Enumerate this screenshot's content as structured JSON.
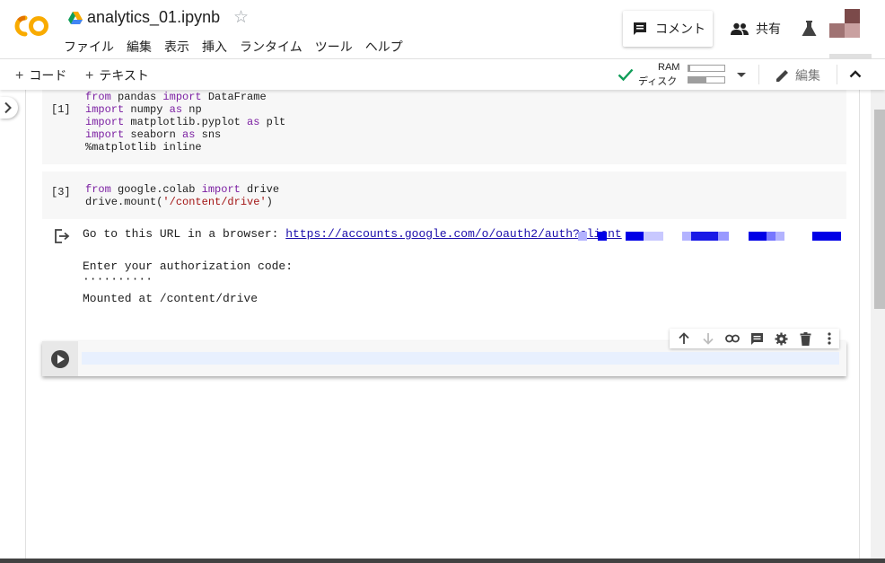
{
  "header": {
    "doc_title": "analytics_01.ipynb",
    "menu": [
      "ファイル",
      "編集",
      "表示",
      "挿入",
      "ランタイム",
      "ツール",
      "ヘルプ"
    ],
    "comment_label": "コメント",
    "share_label": "共有",
    "logo_letters": "CO"
  },
  "toolbar": {
    "add_code_label": "コード",
    "add_text_label": "テキスト",
    "ram_label": "RAM",
    "disk_label": "ディスク",
    "ram_usage": 0.05,
    "disk_usage": 0.5,
    "edit_label": "編集"
  },
  "cells": [
    {
      "exec_count": "[1]",
      "lines": [
        [
          {
            "t": "from",
            "c": "kw"
          },
          {
            "t": " pandas "
          },
          {
            "t": "import",
            "c": "kw"
          },
          {
            "t": " DataFrame"
          }
        ],
        [
          {
            "t": "import",
            "c": "kw"
          },
          {
            "t": " numpy "
          },
          {
            "t": "as",
            "c": "kw"
          },
          {
            "t": " np"
          }
        ],
        [
          {
            "t": "import",
            "c": "kw"
          },
          {
            "t": " matplotlib.pyplot "
          },
          {
            "t": "as",
            "c": "kw"
          },
          {
            "t": " plt"
          }
        ],
        [
          {
            "t": "import",
            "c": "kw"
          },
          {
            "t": " seaborn "
          },
          {
            "t": "as",
            "c": "kw"
          },
          {
            "t": " sns"
          }
        ],
        [
          {
            "t": "%matplotlib inline"
          }
        ]
      ]
    },
    {
      "exec_count": "[3]",
      "lines": [
        [
          {
            "t": "from",
            "c": "kw"
          },
          {
            "t": " google.colab "
          },
          {
            "t": "import",
            "c": "kw"
          },
          {
            "t": " drive"
          }
        ],
        [
          {
            "t": "drive.mount("
          },
          {
            "t": "'/content/drive'",
            "c": "str"
          },
          {
            "t": ")"
          }
        ]
      ]
    }
  ],
  "output": {
    "url_prefix": "Go to this URL in a browser: ",
    "url_link": "https://accounts.google.com/o/oauth2/auth?client",
    "auth_prompt": "Enter your authorization code:",
    "auth_mask": "··········",
    "mounted_text": "Mounted at /content/drive"
  },
  "colors": {
    "accent_orange": "#f9ab00",
    "link_blue": "#1a0dab",
    "keyword_purple": "#7b1fa2",
    "string_red": "#a31515",
    "check_green": "#0f9d58"
  },
  "icons": {
    "comment": "comment-icon",
    "share": "people-icon",
    "flask": "flask-icon",
    "run": "play-icon",
    "cell_toolbar": [
      "arrow-up-icon",
      "arrow-down-icon",
      "link-icon",
      "comment-icon",
      "gear-icon",
      "trash-icon",
      "more-vert-icon"
    ]
  }
}
